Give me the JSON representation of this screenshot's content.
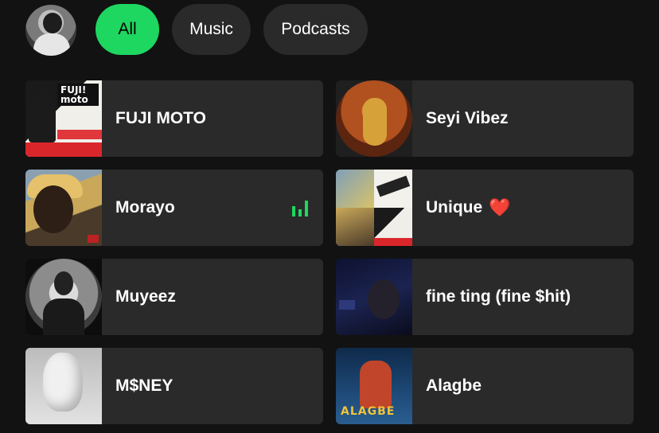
{
  "filters": [
    {
      "label": "All",
      "active": true
    },
    {
      "label": "Music",
      "active": false
    },
    {
      "label": "Podcasts",
      "active": false
    }
  ],
  "tiles": [
    {
      "title": "FUJI MOTO",
      "art": "album-art-fuji-moto"
    },
    {
      "title": "Seyi Vibez",
      "art": "artist-image-seyi-vibez"
    },
    {
      "title": "Morayo",
      "art": "album-art-morayo",
      "now_playing": true
    },
    {
      "title": "Unique",
      "art": "playlist-mosaic-unique",
      "emoji": "❤️"
    },
    {
      "title": "Muyeez",
      "art": "artist-image-muyeez"
    },
    {
      "title": "fine ting (fine $hit)",
      "art": "album-art-fine-ting"
    },
    {
      "title": "M$NEY",
      "art": "album-art-money"
    },
    {
      "title": "Alagbe",
      "art": "album-art-alagbe"
    }
  ],
  "art_text": {
    "fuji_cover": "FUJI! moto",
    "alagbe_cover": "ALAGBE"
  },
  "colors": {
    "accent": "#1ed760",
    "background": "#121212",
    "tile": "#2a2a2a",
    "chip": "#2a2a2a"
  }
}
